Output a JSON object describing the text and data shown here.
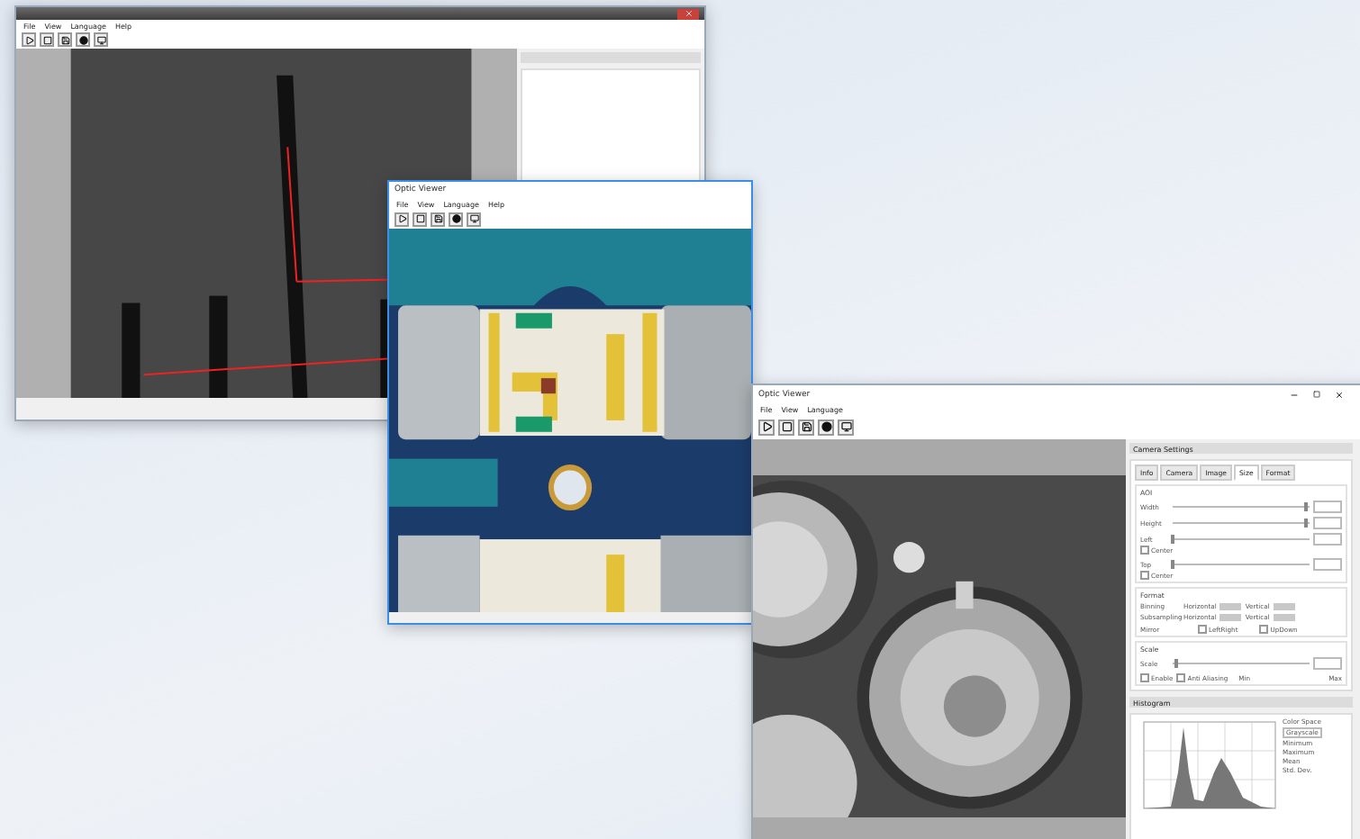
{
  "window_back": {
    "menu": [
      "File",
      "View",
      "Language",
      "Help"
    ]
  },
  "window_middle": {
    "title": "Optic Viewer",
    "menu": [
      "File",
      "View",
      "Language",
      "Help"
    ]
  },
  "window_front": {
    "title": "Optic Viewer",
    "menu": [
      "File",
      "View",
      "Language"
    ],
    "camera_settings": {
      "title": "Camera Settings",
      "tabs": [
        {
          "label": "Info",
          "selected": false
        },
        {
          "label": "Camera",
          "selected": false
        },
        {
          "label": "Image",
          "selected": false
        },
        {
          "label": "Size",
          "selected": true
        },
        {
          "label": "Format",
          "selected": false
        }
      ],
      "aoi": {
        "title": "AOI",
        "rows": [
          {
            "label": "Width",
            "level": 0.97
          },
          {
            "label": "Height",
            "level": 0.97
          },
          {
            "label": "Left",
            "level": 0,
            "center": {
              "label": "Center",
              "checked": false
            }
          },
          {
            "label": "Top",
            "level": 0,
            "center": {
              "label": "Center",
              "checked": false
            }
          }
        ]
      },
      "format": {
        "title": "Format",
        "rows": [
          {
            "label": "Binning",
            "left": "Horizontal",
            "right": "Vertical"
          },
          {
            "label": "Subsampling",
            "left": "Horizontal",
            "right": "Vertical"
          }
        ],
        "mirror": {
          "label": "Mirror",
          "options": [
            {
              "label": "LeftRight",
              "checked": false
            },
            {
              "label": "UpDown",
              "checked": false
            }
          ]
        }
      },
      "scale": {
        "title": "Scale",
        "label": "Scale",
        "level": 0.03,
        "min": "Min",
        "max": "Max",
        "options": [
          {
            "label": "Enable",
            "checked": false
          },
          {
            "label": "Anti Aliasing",
            "checked": false
          }
        ]
      }
    },
    "histogram": {
      "title": "Histogram",
      "color_space_label": "Color Space",
      "color_space": "Grayscale",
      "stats": [
        "Minimum",
        "Maximum",
        "Mean",
        "Std. Dev."
      ]
    }
  }
}
